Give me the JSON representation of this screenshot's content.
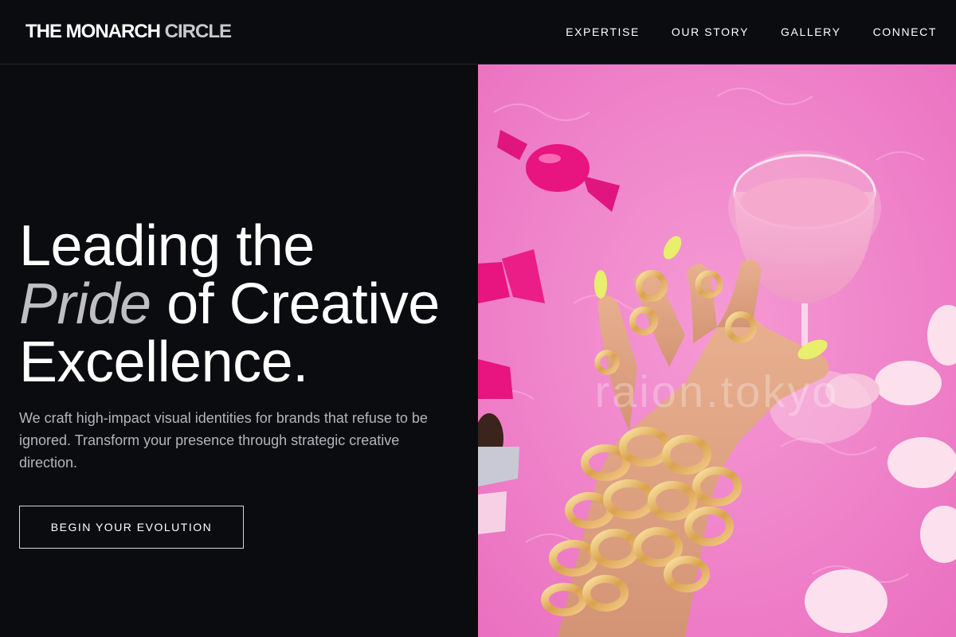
{
  "header": {
    "brand_main": "THE MONARCH",
    "brand_accent": "CIRCLE",
    "nav": [
      "EXPERTISE",
      "OUR STORY",
      "GALLERY",
      "CONNECT"
    ]
  },
  "hero": {
    "headline_line1": "Leading the",
    "headline_em": "Pride",
    "headline_line2_rest": " of Creative",
    "headline_line3": "Excellence.",
    "lead": "We craft high-impact visual identities for brands that refuse to be ignored. Transform your presence through strategic creative direction.",
    "cta_label": "BEGIN YOUR EVOLUTION",
    "image_watermark": "raion.tokyo"
  },
  "colors": {
    "background": "#0b0c10",
    "accent_gray": "#bfbfc3",
    "image_pink": "#f27fc8"
  }
}
